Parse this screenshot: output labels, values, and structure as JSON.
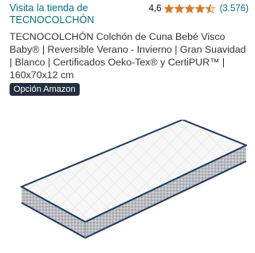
{
  "store": {
    "visit_label_line1": "Visita la tienda de",
    "visit_label_line2": "TECNOCOLCHÓN"
  },
  "rating": {
    "value": "4,6",
    "stars": 4.5,
    "count": "(3.576)",
    "star_color": "#de7921"
  },
  "product": {
    "title": "TECNOCOLCHÓN Colchón de Cuna Bebé Visco Baby® | Reversible Verano - Invierno | Gran Suavidad | Blanco | Certificados Oeko-Tex® y CertiPUR™ | 160x70x12 cm",
    "image_alt": "mattress-image"
  },
  "badge": {
    "label": "Opción Amazon",
    "color": "#232f3e"
  },
  "colors": {
    "link": "#007185",
    "text": "#333333"
  }
}
